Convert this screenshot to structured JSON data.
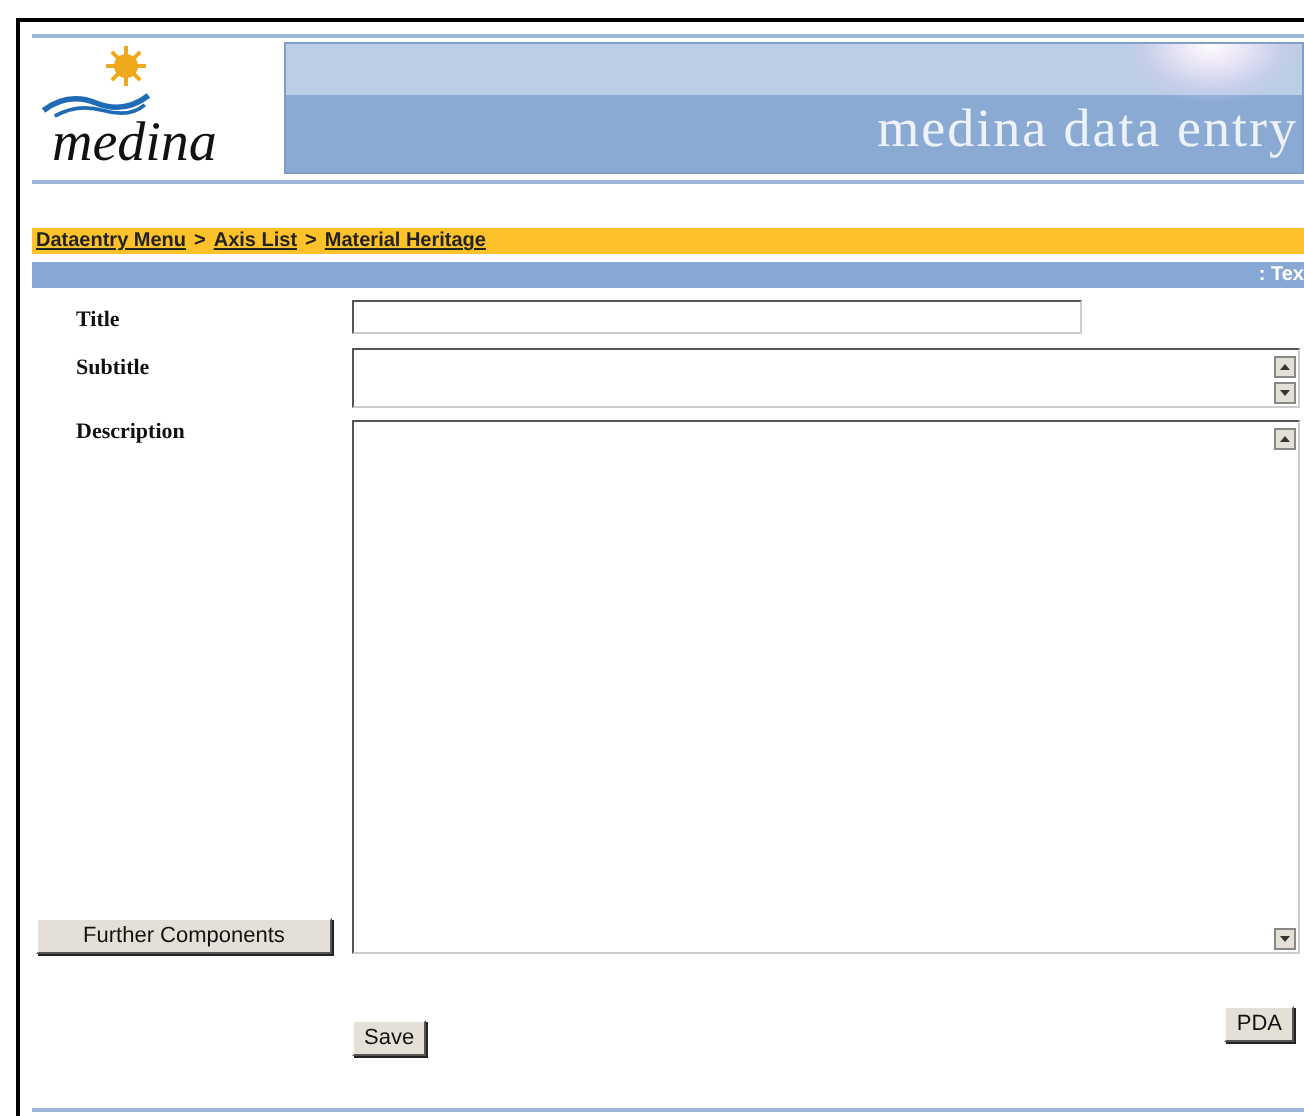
{
  "header": {
    "logo_text": "medina",
    "banner_title": "medina data entry"
  },
  "breadcrumb": [
    {
      "kind": "link",
      "text": "Dataentry Menu"
    },
    {
      "kind": "sep",
      "text": ">"
    },
    {
      "kind": "link",
      "text": "Axis List"
    },
    {
      "kind": "sep",
      "text": ">"
    },
    {
      "kind": "link",
      "text": "Material Heritage"
    }
  ],
  "section_bar": {
    "label": ": Tex"
  },
  "fields": [
    {
      "label": "Title",
      "kind": "line"
    },
    {
      "label": "Subtitle",
      "kind": "scroll"
    },
    {
      "label": "Description",
      "kind": "area"
    }
  ],
  "further_button": "Further Components",
  "save_button": "Save",
  "pda_button": "PDA"
}
